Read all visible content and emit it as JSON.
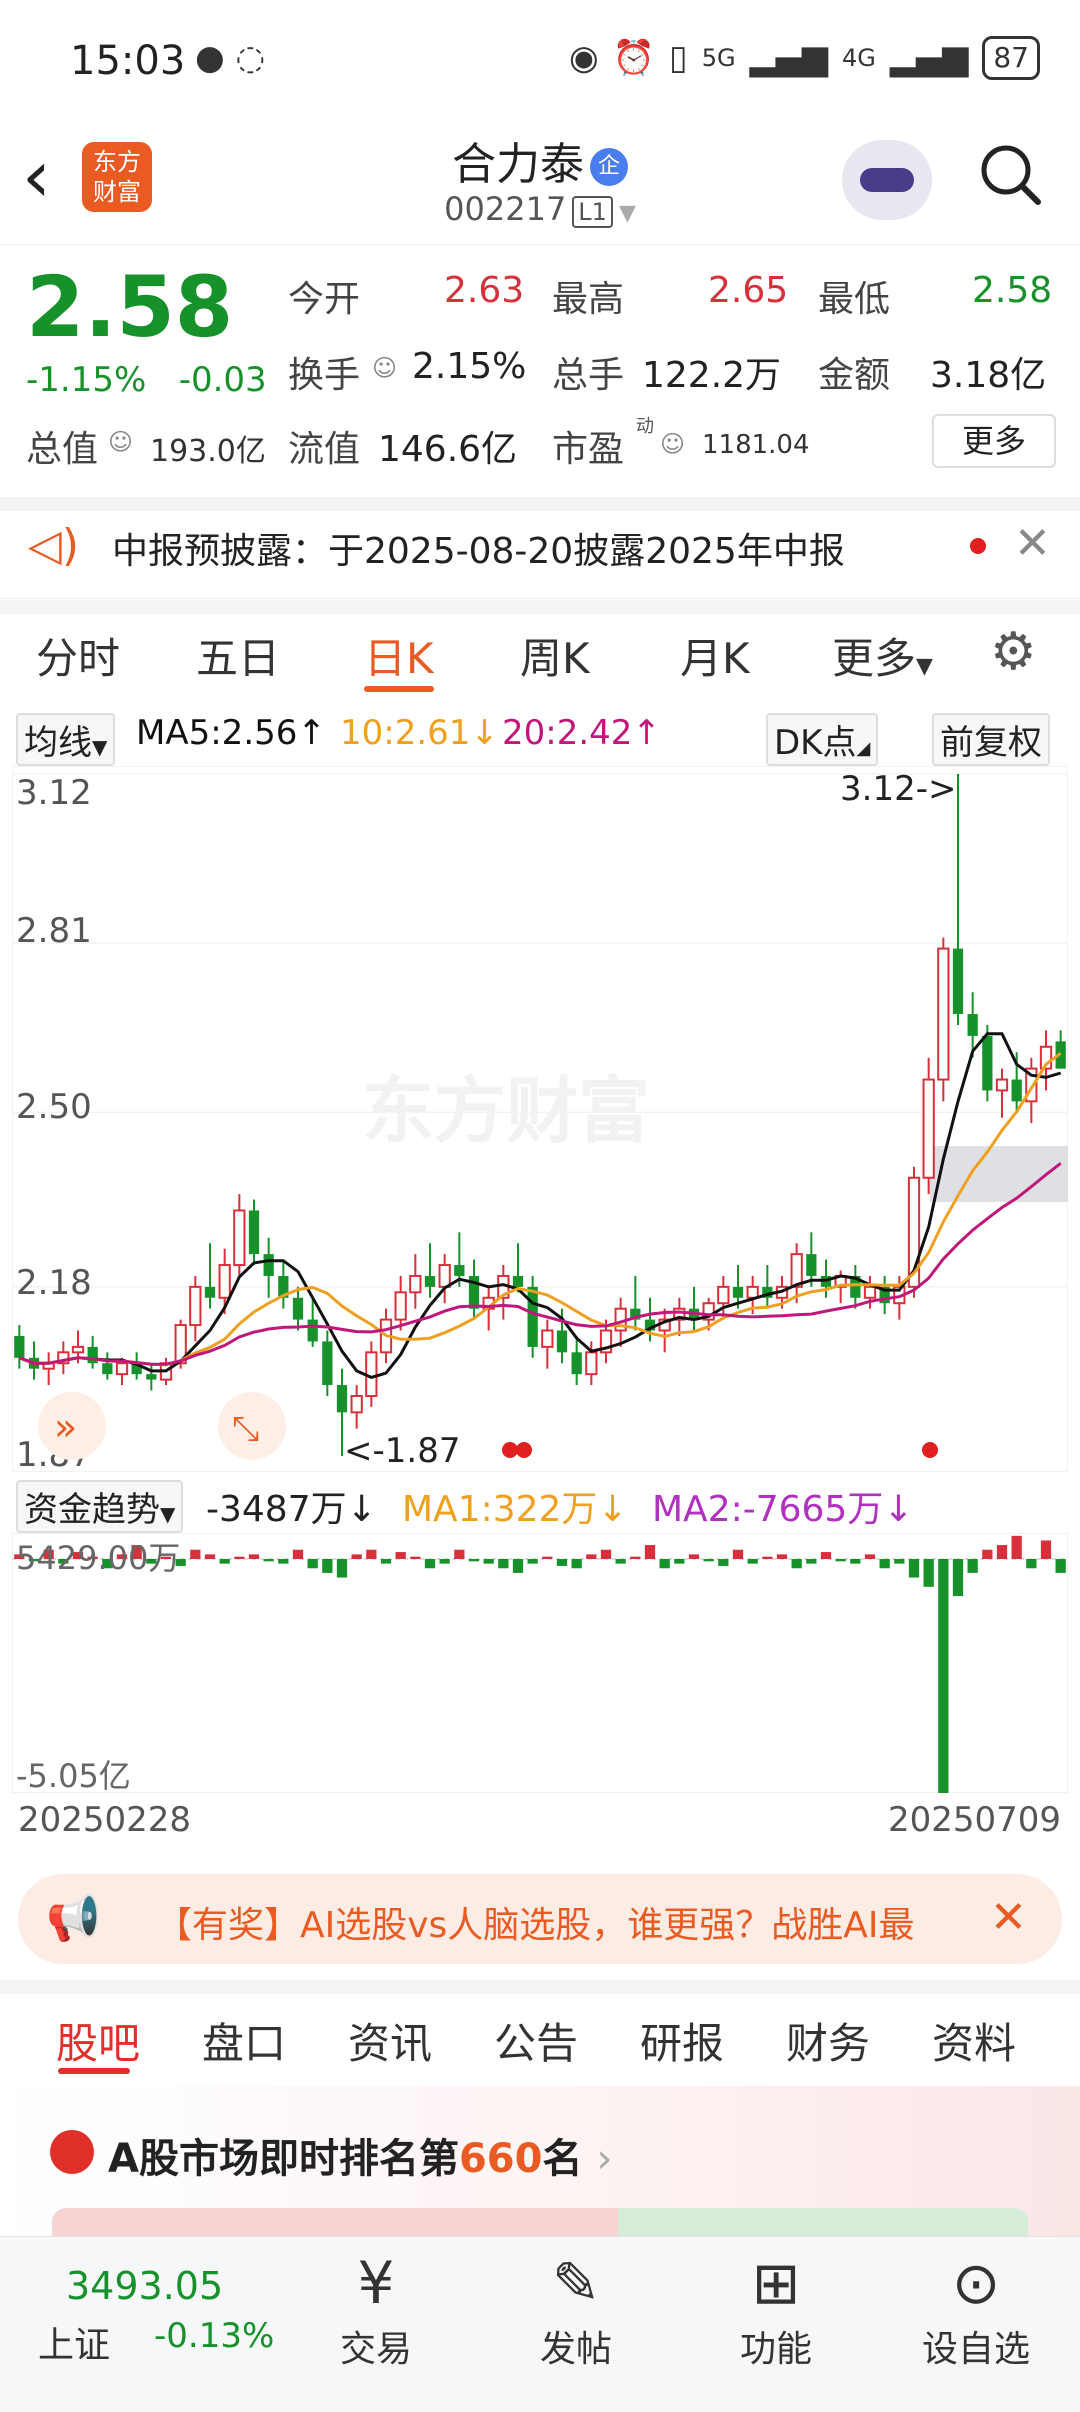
{
  "status_bar": {
    "time": "15:03",
    "battery": "87",
    "net1": "5G",
    "net2": "4G"
  },
  "header": {
    "logo_text_1": "东方",
    "logo_text_2": "财富",
    "name": "合力泰",
    "badge": "企",
    "code": "002217",
    "level": "L1"
  },
  "quote": {
    "price": "2.58",
    "pct": "-1.15%",
    "chg": "-0.03",
    "open_label": "今开",
    "open": "2.63",
    "high_label": "最高",
    "high": "2.65",
    "low_label": "最低",
    "low": "2.58",
    "turnover_label": "换手",
    "turnover": "2.15%",
    "volume_label": "总手",
    "volume": "122.2万",
    "amount_label": "金额",
    "amount": "3.18亿",
    "mktcap_label": "总值",
    "mktcap": "193.0亿",
    "float_label": "流值",
    "float": "146.6亿",
    "pe_label": "市盈",
    "pe_sup": "动",
    "pe": "1181.04",
    "more": "更多"
  },
  "notice": {
    "text": "中报预披露：于2025-08-20披露2025年中报"
  },
  "period_tabs": [
    "分时",
    "五日",
    "日K",
    "周K",
    "月K",
    "更多"
  ],
  "ma": {
    "selector": "均线",
    "ma5": "MA5:2.56",
    "ma10": "10:2.61",
    "ma20": "20:2.42",
    "dk": "DK点",
    "adjust": "前复权"
  },
  "kchart": {
    "y_labels": [
      "3.12",
      "2.81",
      "2.50",
      "2.18",
      "1.87"
    ],
    "max_note": "3.12->",
    "min_note": "<-1.87",
    "watermark": "东方财富"
  },
  "fund": {
    "selector": "资金趋势",
    "value": "-3487万",
    "ma1": "MA1:322万",
    "ma2": "MA2:-7665万",
    "y_top": "5429.00万",
    "y_bottom": "-5.05亿",
    "date_start": "20250228",
    "date_end": "20250709"
  },
  "promo": {
    "text": "【有奖】AI选股vs人脑选股，谁更强？战胜AI最"
  },
  "community_tabs": [
    "股吧",
    "盘口",
    "资讯",
    "公告",
    "研报",
    "财务",
    "资料"
  ],
  "rank": {
    "prefix": "A股市场即时排名第",
    "num": "660",
    "suffix": "名"
  },
  "bottom_nav": {
    "index_value": "3493.05",
    "index_name": "上证",
    "index_pct": "-0.13%",
    "items": [
      "交易",
      "发帖",
      "功能",
      "设自选"
    ]
  },
  "colors": {
    "up": "#d8303a",
    "down": "#17922b",
    "accent": "#ea5a23",
    "ma5": "#111111",
    "ma10": "#f0a020",
    "ma20": "#c0187a"
  },
  "chart_data": {
    "type": "candlestick",
    "ylim": [
      1.87,
      3.12
    ],
    "ohlc": [
      [
        2.09,
        2.11,
        2.03,
        2.05
      ],
      [
        2.05,
        2.08,
        2.01,
        2.03
      ],
      [
        2.03,
        2.06,
        2.0,
        2.04
      ],
      [
        2.04,
        2.08,
        2.02,
        2.06
      ],
      [
        2.06,
        2.1,
        2.04,
        2.07
      ],
      [
        2.07,
        2.09,
        2.03,
        2.04
      ],
      [
        2.04,
        2.06,
        2.01,
        2.02
      ],
      [
        2.02,
        2.05,
        2.0,
        2.04
      ],
      [
        2.04,
        2.06,
        2.01,
        2.02
      ],
      [
        2.02,
        2.04,
        1.99,
        2.01
      ],
      [
        2.01,
        2.05,
        2.0,
        2.04
      ],
      [
        2.04,
        2.12,
        2.03,
        2.11
      ],
      [
        2.11,
        2.2,
        2.08,
        2.18
      ],
      [
        2.18,
        2.26,
        2.14,
        2.16
      ],
      [
        2.16,
        2.25,
        2.13,
        2.22
      ],
      [
        2.22,
        2.35,
        2.2,
        2.32
      ],
      [
        2.32,
        2.34,
        2.22,
        2.24
      ],
      [
        2.24,
        2.27,
        2.16,
        2.2
      ],
      [
        2.2,
        2.23,
        2.14,
        2.16
      ],
      [
        2.16,
        2.18,
        2.1,
        2.12
      ],
      [
        2.12,
        2.16,
        2.07,
        2.08
      ],
      [
        2.08,
        2.1,
        1.98,
        2.0
      ],
      [
        2.0,
        2.03,
        1.87,
        1.95
      ],
      [
        1.95,
        2.0,
        1.92,
        1.98
      ],
      [
        1.98,
        2.08,
        1.96,
        2.06
      ],
      [
        2.06,
        2.14,
        2.04,
        2.12
      ],
      [
        2.12,
        2.2,
        2.1,
        2.17
      ],
      [
        2.17,
        2.24,
        2.14,
        2.2
      ],
      [
        2.2,
        2.26,
        2.16,
        2.18
      ],
      [
        2.18,
        2.24,
        2.15,
        2.22
      ],
      [
        2.22,
        2.28,
        2.18,
        2.2
      ],
      [
        2.2,
        2.23,
        2.12,
        2.14
      ],
      [
        2.14,
        2.18,
        2.1,
        2.16
      ],
      [
        2.16,
        2.22,
        2.12,
        2.2
      ],
      [
        2.2,
        2.26,
        2.17,
        2.18
      ],
      [
        2.18,
        2.2,
        2.05,
        2.07
      ],
      [
        2.07,
        2.12,
        2.03,
        2.1
      ],
      [
        2.1,
        2.14,
        2.04,
        2.06
      ],
      [
        2.06,
        2.09,
        2.0,
        2.02
      ],
      [
        2.02,
        2.08,
        2.0,
        2.06
      ],
      [
        2.06,
        2.12,
        2.04,
        2.1
      ],
      [
        2.1,
        2.16,
        2.07,
        2.14
      ],
      [
        2.14,
        2.2,
        2.1,
        2.12
      ],
      [
        2.12,
        2.16,
        2.08,
        2.1
      ],
      [
        2.1,
        2.14,
        2.06,
        2.12
      ],
      [
        2.12,
        2.16,
        2.09,
        2.14
      ],
      [
        2.14,
        2.18,
        2.1,
        2.12
      ],
      [
        2.12,
        2.16,
        2.1,
        2.15
      ],
      [
        2.15,
        2.2,
        2.12,
        2.18
      ],
      [
        2.18,
        2.22,
        2.14,
        2.16
      ],
      [
        2.16,
        2.2,
        2.13,
        2.18
      ],
      [
        2.18,
        2.22,
        2.14,
        2.16
      ],
      [
        2.16,
        2.2,
        2.14,
        2.18
      ],
      [
        2.18,
        2.26,
        2.15,
        2.24
      ],
      [
        2.24,
        2.28,
        2.18,
        2.2
      ],
      [
        2.2,
        2.23,
        2.16,
        2.18
      ],
      [
        2.18,
        2.21,
        2.15,
        2.2
      ],
      [
        2.2,
        2.22,
        2.14,
        2.16
      ],
      [
        2.16,
        2.2,
        2.14,
        2.18
      ],
      [
        2.18,
        2.2,
        2.13,
        2.15
      ],
      [
        2.15,
        2.2,
        2.12,
        2.18
      ],
      [
        2.18,
        2.4,
        2.16,
        2.38
      ],
      [
        2.38,
        2.6,
        2.35,
        2.56
      ],
      [
        2.56,
        2.82,
        2.52,
        2.8
      ],
      [
        2.8,
        3.12,
        2.66,
        2.68
      ],
      [
        2.68,
        2.72,
        2.6,
        2.64
      ],
      [
        2.64,
        2.66,
        2.52,
        2.54
      ],
      [
        2.54,
        2.58,
        2.49,
        2.56
      ],
      [
        2.56,
        2.61,
        2.5,
        2.52
      ],
      [
        2.52,
        2.6,
        2.48,
        2.58
      ],
      [
        2.58,
        2.65,
        2.54,
        2.62
      ],
      [
        2.63,
        2.65,
        2.58,
        2.58
      ]
    ],
    "fund_flow": [
      0.1,
      -0.05,
      0.2,
      -0.1,
      0.15,
      0.05,
      -0.2,
      0.1,
      0.3,
      -0.1,
      0.05,
      -0.15,
      0.2,
      0.1,
      -0.1,
      0.05,
      0.1,
      -0.05,
      -0.1,
      0.2,
      -0.2,
      -0.3,
      -0.4,
      0.1,
      0.2,
      -0.1,
      0.15,
      0.05,
      -0.2,
      -0.1,
      0.2,
      -0.05,
      -0.1,
      -0.2,
      -0.3,
      -0.1,
      0.05,
      -0.15,
      -0.2,
      0.1,
      0.2,
      -0.1,
      0.05,
      0.3,
      -0.2,
      -0.1,
      0.1,
      -0.05,
      -0.15,
      0.2,
      -0.1,
      0.05,
      0.1,
      -0.2,
      -0.1,
      0.15,
      -0.05,
      -0.1,
      0.1,
      -0.2,
      -0.1,
      -0.4,
      -0.6,
      -5.05,
      -0.8,
      -0.3,
      0.2,
      0.3,
      0.5,
      -0.2,
      0.4,
      -0.3
    ]
  }
}
